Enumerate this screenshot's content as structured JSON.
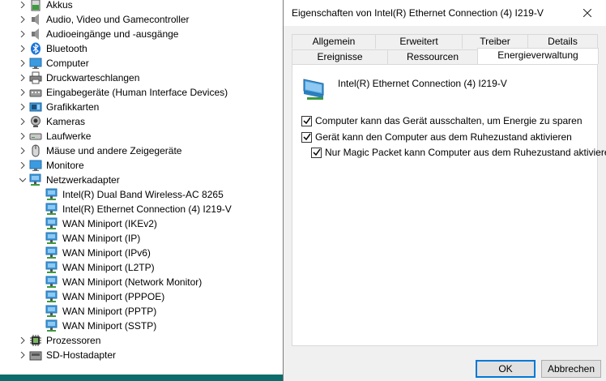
{
  "device_manager": {
    "categories": [
      {
        "label": "Akkus",
        "icon": "battery-icon"
      },
      {
        "label": "Audio, Video und Gamecontroller",
        "icon": "speaker-icon"
      },
      {
        "label": "Audioeingänge und -ausgänge",
        "icon": "speaker-icon"
      },
      {
        "label": "Bluetooth",
        "icon": "bluetooth-icon"
      },
      {
        "label": "Computer",
        "icon": "monitor-icon"
      },
      {
        "label": "Druckwarteschlangen",
        "icon": "printer-icon"
      },
      {
        "label": "Eingabegeräte (Human Interface Devices)",
        "icon": "hid-icon"
      },
      {
        "label": "Grafikkarten",
        "icon": "graphics-card-icon"
      },
      {
        "label": "Kameras",
        "icon": "camera-icon"
      },
      {
        "label": "Laufwerke",
        "icon": "drive-icon"
      },
      {
        "label": "Mäuse und andere Zeigegeräte",
        "icon": "mouse-icon"
      },
      {
        "label": "Monitore",
        "icon": "monitor-icon"
      },
      {
        "label": "Netzwerkadapter",
        "icon": "network-adapter-icon",
        "expanded": true
      },
      {
        "label": "Prozessoren",
        "icon": "processor-icon"
      },
      {
        "label": "SD-Hostadapter",
        "icon": "sd-host-icon"
      }
    ],
    "network_adapters": [
      "Intel(R) Dual Band Wireless-AC 8265",
      "Intel(R) Ethernet Connection (4) I219-V",
      "WAN Miniport (IKEv2)",
      "WAN Miniport (IP)",
      "WAN Miniport (IPv6)",
      "WAN Miniport (L2TP)",
      "WAN Miniport (Network Monitor)",
      "WAN Miniport (PPPOE)",
      "WAN Miniport (PPTP)",
      "WAN Miniport (SSTP)"
    ]
  },
  "dialog": {
    "title": "Eigenschaften von Intel(R) Ethernet Connection (4) I219-V",
    "tabs_back": [
      "Allgemein",
      "Erweitert",
      "Treiber",
      "Details"
    ],
    "tabs_front": [
      "Ereignisse",
      "Ressourcen",
      "Energieverwaltung"
    ],
    "active_tab": "Energieverwaltung",
    "device_name": "Intel(R) Ethernet Connection (4) I219-V",
    "options": [
      {
        "label": "Computer kann das Gerät ausschalten, um Energie zu sparen",
        "checked": true
      },
      {
        "label": "Gerät kann den Computer aus dem Ruhezustand aktivieren",
        "checked": true
      },
      {
        "label": "Nur Magic Packet kann Computer aus dem Ruhezustand aktivieren",
        "checked": true
      }
    ],
    "ok_label": "OK",
    "cancel_label": "Abbrechen"
  },
  "colors": {
    "accent": "#0078d7",
    "taskbar": "#0a6d6b"
  }
}
